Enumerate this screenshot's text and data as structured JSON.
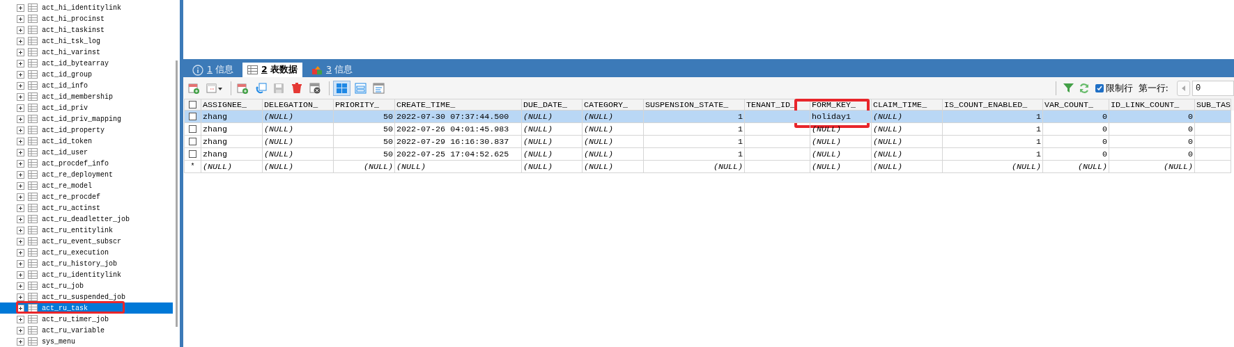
{
  "tree": {
    "items": [
      {
        "name": "act_hi_identitylink",
        "selected": false,
        "expanded": false,
        "highlighted": false
      },
      {
        "name": "act_hi_procinst",
        "selected": false,
        "expanded": false,
        "highlighted": false
      },
      {
        "name": "act_hi_taskinst",
        "selected": false,
        "expanded": false,
        "highlighted": false
      },
      {
        "name": "act_hi_tsk_log",
        "selected": false,
        "expanded": false,
        "highlighted": false
      },
      {
        "name": "act_hi_varinst",
        "selected": false,
        "expanded": false,
        "highlighted": false
      },
      {
        "name": "act_id_bytearray",
        "selected": false,
        "expanded": false,
        "highlighted": false
      },
      {
        "name": "act_id_group",
        "selected": false,
        "expanded": false,
        "highlighted": false
      },
      {
        "name": "act_id_info",
        "selected": false,
        "expanded": false,
        "highlighted": false
      },
      {
        "name": "act_id_membership",
        "selected": false,
        "expanded": false,
        "highlighted": false
      },
      {
        "name": "act_id_priv",
        "selected": false,
        "expanded": false,
        "highlighted": false
      },
      {
        "name": "act_id_priv_mapping",
        "selected": false,
        "expanded": false,
        "highlighted": false
      },
      {
        "name": "act_id_property",
        "selected": false,
        "expanded": false,
        "highlighted": false
      },
      {
        "name": "act_id_token",
        "selected": false,
        "expanded": false,
        "highlighted": false
      },
      {
        "name": "act_id_user",
        "selected": false,
        "expanded": false,
        "highlighted": false
      },
      {
        "name": "act_procdef_info",
        "selected": false,
        "expanded": false,
        "highlighted": false
      },
      {
        "name": "act_re_deployment",
        "selected": false,
        "expanded": false,
        "highlighted": false
      },
      {
        "name": "act_re_model",
        "selected": false,
        "expanded": false,
        "highlighted": false
      },
      {
        "name": "act_re_procdef",
        "selected": false,
        "expanded": false,
        "highlighted": false
      },
      {
        "name": "act_ru_actinst",
        "selected": false,
        "expanded": false,
        "highlighted": false
      },
      {
        "name": "act_ru_deadletter_job",
        "selected": false,
        "expanded": false,
        "highlighted": false
      },
      {
        "name": "act_ru_entitylink",
        "selected": false,
        "expanded": false,
        "highlighted": false
      },
      {
        "name": "act_ru_event_subscr",
        "selected": false,
        "expanded": false,
        "highlighted": false
      },
      {
        "name": "act_ru_execution",
        "selected": false,
        "expanded": false,
        "highlighted": false
      },
      {
        "name": "act_ru_history_job",
        "selected": false,
        "expanded": false,
        "highlighted": false
      },
      {
        "name": "act_ru_identitylink",
        "selected": false,
        "expanded": false,
        "highlighted": false
      },
      {
        "name": "act_ru_job",
        "selected": false,
        "expanded": false,
        "highlighted": false
      },
      {
        "name": "act_ru_suspended_job",
        "selected": false,
        "expanded": false,
        "highlighted": false
      },
      {
        "name": "act_ru_task",
        "selected": true,
        "expanded": false,
        "highlighted": true
      },
      {
        "name": "act_ru_timer_job",
        "selected": false,
        "expanded": false,
        "highlighted": false
      },
      {
        "name": "act_ru_variable",
        "selected": false,
        "expanded": false,
        "highlighted": false
      },
      {
        "name": "sys_menu",
        "selected": false,
        "expanded": false,
        "highlighted": false
      }
    ]
  },
  "tabs": [
    {
      "number": "1",
      "label": "信息",
      "selected": false
    },
    {
      "number": "2",
      "label": "表数据",
      "selected": true
    },
    {
      "number": "3",
      "label": "信息",
      "selected": false
    }
  ],
  "toolbar": {
    "tools": [
      {
        "kind": "new-record",
        "disabled": false
      },
      {
        "kind": "grid-menu",
        "disabled": false
      },
      {
        "kind": "add",
        "disabled": false
      },
      {
        "kind": "refresh",
        "disabled": false
      },
      {
        "kind": "save",
        "disabled": true
      },
      {
        "kind": "delete",
        "disabled": false
      },
      {
        "kind": "discard",
        "disabled": false
      }
    ],
    "views": [
      {
        "kind": "grid",
        "selected": true
      },
      {
        "kind": "form",
        "selected": false
      },
      {
        "kind": "text",
        "selected": false
      }
    ],
    "limit_rows": {
      "label": "限制行",
      "checked": true
    },
    "first_row": {
      "label": "第一行:",
      "value": "0"
    }
  },
  "grid": {
    "all_checked": false,
    "columns": [
      {
        "name": "ASSIGNEE_",
        "highlighted": false
      },
      {
        "name": "DELEGATION_",
        "highlighted": false
      },
      {
        "name": "PRIORITY_",
        "highlighted": false
      },
      {
        "name": "CREATE_TIME_",
        "highlighted": false
      },
      {
        "name": "DUE_DATE_",
        "highlighted": false
      },
      {
        "name": "CATEGORY_",
        "highlighted": false
      },
      {
        "name": "SUSPENSION_STATE_",
        "highlighted": false
      },
      {
        "name": "TENANT_ID_",
        "highlighted": false
      },
      {
        "name": "FORM_KEY_",
        "highlighted": true
      },
      {
        "name": "CLAIM_TIME_",
        "highlighted": false
      },
      {
        "name": "IS_COUNT_ENABLED_",
        "highlighted": false
      },
      {
        "name": "VAR_COUNT_",
        "highlighted": false
      },
      {
        "name": "ID_LINK_COUNT_",
        "highlighted": false
      },
      {
        "name": "SUB_TAS",
        "highlighted": false
      }
    ],
    "rows": [
      {
        "kind": "record",
        "checked": false,
        "selected": true,
        "cells": [
          "zhang",
          {
            "text": "(NULL)",
            "kind": "null"
          },
          "50",
          "2022-07-30 07:37:44.500",
          {
            "text": "(NULL)",
            "kind": "null"
          },
          {
            "text": "(NULL)",
            "kind": "null"
          },
          "1",
          null,
          "holiday1",
          {
            "text": "(NULL)",
            "kind": "null"
          },
          "1",
          "0",
          "0",
          null
        ]
      },
      {
        "kind": "record",
        "checked": false,
        "selected": false,
        "cells": [
          "zhang",
          {
            "text": "(NULL)",
            "kind": "null"
          },
          "50",
          "2022-07-26 04:01:45.983",
          {
            "text": "(NULL)",
            "kind": "null"
          },
          {
            "text": "(NULL)",
            "kind": "null"
          },
          "1",
          null,
          {
            "text": "(NULL)",
            "kind": "null"
          },
          {
            "text": "(NULL)",
            "kind": "null"
          },
          "1",
          "0",
          "0",
          null
        ]
      },
      {
        "kind": "record",
        "checked": false,
        "selected": false,
        "cells": [
          "zhang",
          {
            "text": "(NULL)",
            "kind": "null"
          },
          "50",
          "2022-07-29 16:16:30.837",
          {
            "text": "(NULL)",
            "kind": "null"
          },
          {
            "text": "(NULL)",
            "kind": "null"
          },
          "1",
          null,
          {
            "text": "(NULL)",
            "kind": "null"
          },
          {
            "text": "(NULL)",
            "kind": "null"
          },
          "1",
          "0",
          "0",
          null
        ]
      },
      {
        "kind": "record",
        "checked": false,
        "selected": false,
        "cells": [
          "zhang",
          {
            "text": "(NULL)",
            "kind": "null"
          },
          "50",
          "2022-07-25 17:04:52.625",
          {
            "text": "(NULL)",
            "kind": "null"
          },
          {
            "text": "(NULL)",
            "kind": "null"
          },
          "1",
          null,
          {
            "text": "(NULL)",
            "kind": "null"
          },
          {
            "text": "(NULL)",
            "kind": "null"
          },
          "1",
          "0",
          "0",
          null
        ]
      },
      {
        "kind": "new",
        "marker": "*",
        "selected": false,
        "cells": [
          {
            "text": "(NULL)",
            "kind": "null"
          },
          {
            "text": "(NULL)",
            "kind": "null"
          },
          {
            "text": "(NULL)",
            "kind": "null"
          },
          {
            "text": "(NULL)",
            "kind": "null"
          },
          {
            "text": "(NULL)",
            "kind": "null"
          },
          {
            "text": "(NULL)",
            "kind": "null"
          },
          {
            "text": "(NULL)",
            "kind": "null"
          },
          null,
          {
            "text": "(NULL)",
            "kind": "null"
          },
          {
            "text": "(NULL)",
            "kind": "null"
          },
          {
            "text": "(NULL)",
            "kind": "null"
          },
          {
            "text": "(NULL)",
            "kind": "null"
          },
          {
            "text": "(NULL)",
            "kind": "null"
          },
          null
        ]
      }
    ]
  }
}
